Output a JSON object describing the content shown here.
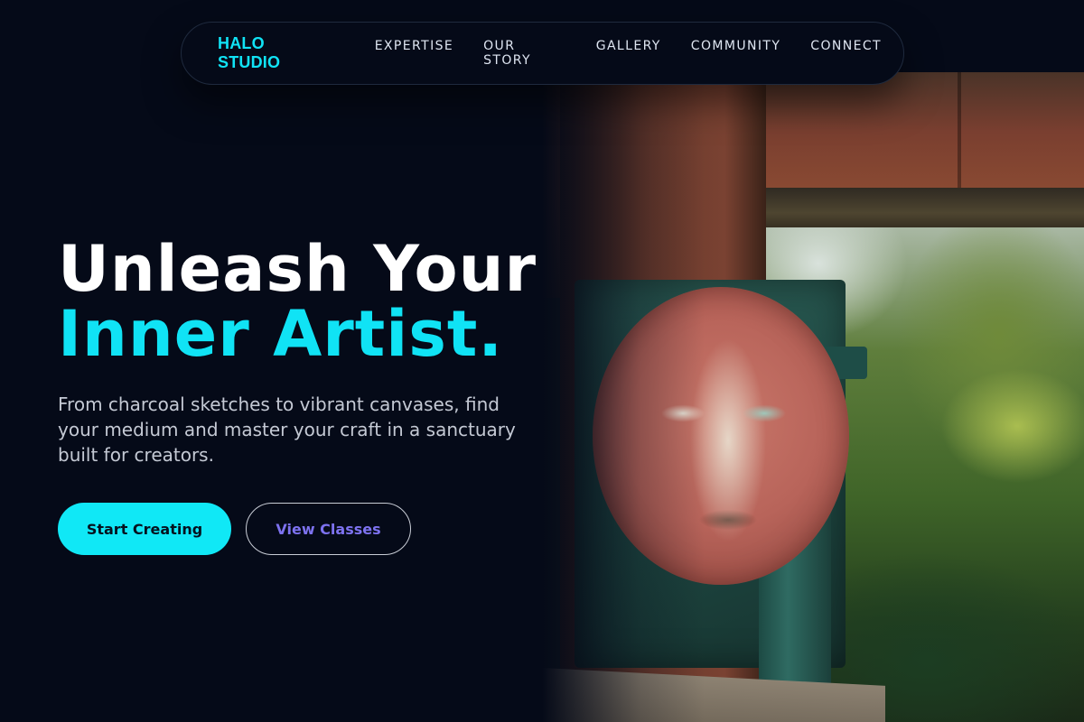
{
  "nav": {
    "brand": "HALO STUDIO",
    "links": [
      "EXPERTISE",
      "OUR STORY",
      "GALLERY",
      "COMMUNITY",
      "CONNECT"
    ]
  },
  "hero": {
    "headline_line1": "Unleash Your",
    "headline_line2": "Inner Artist.",
    "subtitle": "From charcoal sketches to vibrant canvases, find your medium and master your craft in a sanctuary built for creators.",
    "primary_cta": "Start Creating",
    "secondary_cta": "View Classes"
  },
  "colors": {
    "background": "#050a18",
    "accent_cyan": "#10e3f5",
    "secondary_violet": "#7d72ef"
  }
}
